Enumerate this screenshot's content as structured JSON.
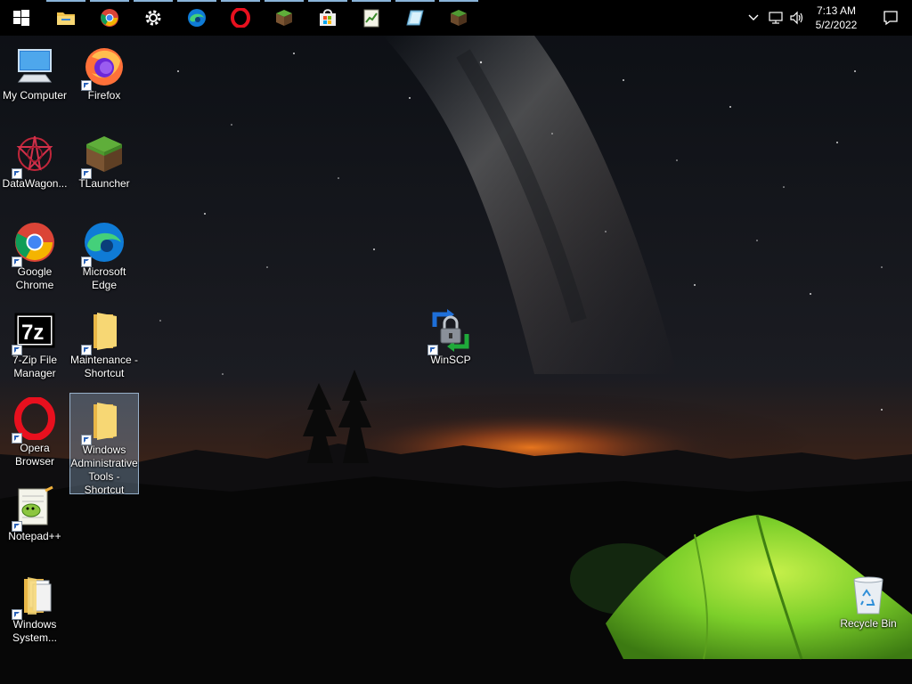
{
  "taskbar": {
    "start": "windows-start-icon",
    "pinned": [
      {
        "name": "file-explorer-icon"
      },
      {
        "name": "chrome-icon"
      },
      {
        "name": "settings-gear-icon"
      },
      {
        "name": "edge-icon"
      },
      {
        "name": "opera-icon"
      },
      {
        "name": "minecraft-grass-icon"
      },
      {
        "name": "microsoft-store-icon"
      },
      {
        "name": "notepad-chart-icon"
      },
      {
        "name": "remote-desktop-icon"
      },
      {
        "name": "tlauncher-grass-icon"
      }
    ],
    "tray": {
      "chevron": "chevron-up-icon",
      "network": "network-icon",
      "volume": "volume-icon",
      "time": "7:13 AM",
      "date": "5/2/2022",
      "notifications": "notification-icon"
    }
  },
  "desktop": {
    "icons": [
      {
        "label": "My Computer"
      },
      {
        "label": "Firefox"
      },
      {
        "label": "DataWagon..."
      },
      {
        "label": "TLauncher"
      },
      {
        "label": "Google Chrome"
      },
      {
        "label": "Microsoft Edge"
      },
      {
        "label": "7-Zip File Manager"
      },
      {
        "label": "Maintenance - Shortcut"
      },
      {
        "label": "Opera Browser"
      },
      {
        "label": "Windows Administrative Tools - Shortcut"
      },
      {
        "label": "Notepad++"
      },
      {
        "label": "Windows System..."
      },
      {
        "label": "WinSCP"
      },
      {
        "label": "Recycle Bin"
      }
    ]
  },
  "colors": {
    "taskbar_bg": "#000000",
    "selection": "#99b4d1",
    "tent": "#7ccf2a",
    "glow": "#e06a1a"
  }
}
